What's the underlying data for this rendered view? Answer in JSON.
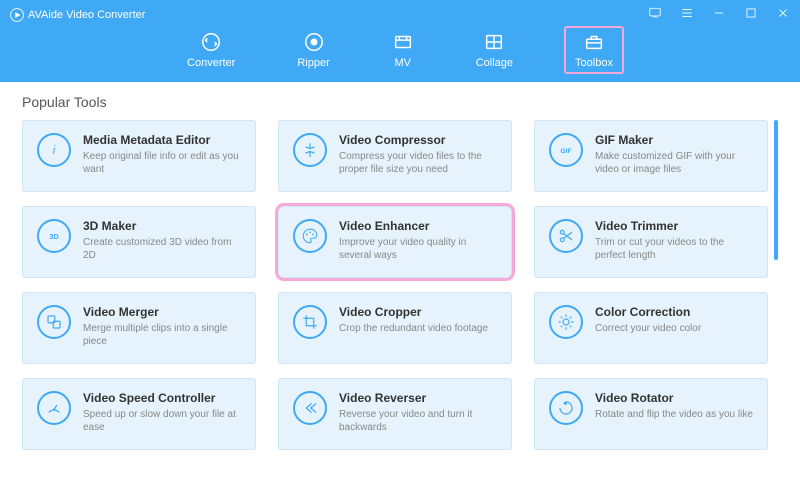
{
  "app_title": "AVAide Video Converter",
  "tabs": [
    {
      "id": "converter",
      "label": "Converter"
    },
    {
      "id": "ripper",
      "label": "Ripper"
    },
    {
      "id": "mv",
      "label": "MV"
    },
    {
      "id": "collage",
      "label": "Collage"
    },
    {
      "id": "toolbox",
      "label": "Toolbox",
      "selected": true
    }
  ],
  "section_title": "Popular Tools",
  "tools": [
    {
      "icon": "info",
      "title": "Media Metadata Editor",
      "desc": "Keep original file info or edit as you want"
    },
    {
      "icon": "compress",
      "title": "Video Compressor",
      "desc": "Compress your video files to the proper file size you need"
    },
    {
      "icon": "gif",
      "title": "GIF Maker",
      "desc": "Make customized GIF with your video or image files"
    },
    {
      "icon": "3d",
      "title": "3D Maker",
      "desc": "Create customized 3D video from 2D"
    },
    {
      "icon": "palette",
      "title": "Video Enhancer",
      "desc": "Improve your video quality in several ways",
      "highlight": true
    },
    {
      "icon": "scissors",
      "title": "Video Trimmer",
      "desc": "Trim or cut your videos to the perfect length"
    },
    {
      "icon": "merge",
      "title": "Video Merger",
      "desc": "Merge multiple clips into a single piece"
    },
    {
      "icon": "crop",
      "title": "Video Cropper",
      "desc": "Crop the redundant video footage"
    },
    {
      "icon": "sun",
      "title": "Color Correction",
      "desc": "Correct your video color"
    },
    {
      "icon": "speed",
      "title": "Video Speed Controller",
      "desc": "Speed up or slow down your file at ease"
    },
    {
      "icon": "reverse",
      "title": "Video Reverser",
      "desc": "Reverse your video and turn it backwards"
    },
    {
      "icon": "rotate",
      "title": "Video Rotator",
      "desc": "Rotate and flip the video as you like"
    }
  ]
}
